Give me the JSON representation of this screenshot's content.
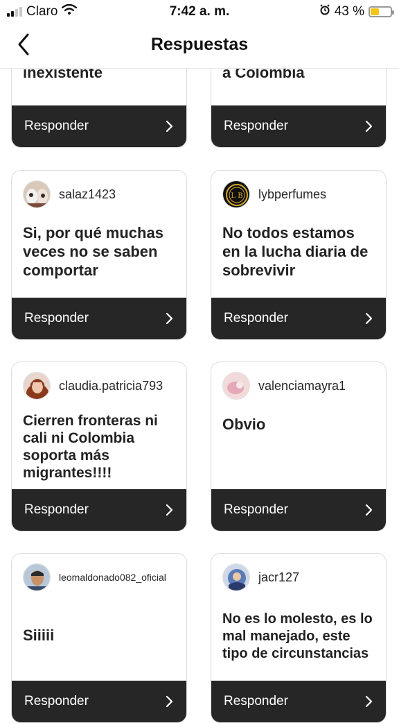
{
  "status": {
    "carrier": "Claro",
    "time": "7:42 a. m.",
    "battery": "43 %"
  },
  "header": {
    "title": "Respuestas"
  },
  "reply_label": "Responder",
  "partial": [
    {
      "text": "inexistente"
    },
    {
      "text": "a Colombia"
    }
  ],
  "cards": [
    {
      "username": "salaz1423",
      "text": "Si, por qué muchas veces no se saben comportar"
    },
    {
      "username": "lybperfumes",
      "text": "No todos estamos en la lucha diaria de sobrevivir"
    },
    {
      "username": "claudia.patricia793",
      "text": "Cierren fronteras ni cali ni Colombia soporta más migrantes!!!!"
    },
    {
      "username": "valenciamayra1",
      "text": "Obvio"
    },
    {
      "username": "leomaldonado082_oficial",
      "text": "Siiiii"
    },
    {
      "username": "jacr127",
      "text": "No es lo molesto, es lo mal  manejado, este tipo de circunstancias"
    }
  ],
  "icons": {
    "back": "chevron-left-icon",
    "forward": "chevron-right-icon",
    "wifi": "wifi-icon",
    "alarm": "alarm-icon",
    "battery": "battery-icon"
  },
  "colors": {
    "footer": "#262626",
    "battery": "#f5c518"
  }
}
